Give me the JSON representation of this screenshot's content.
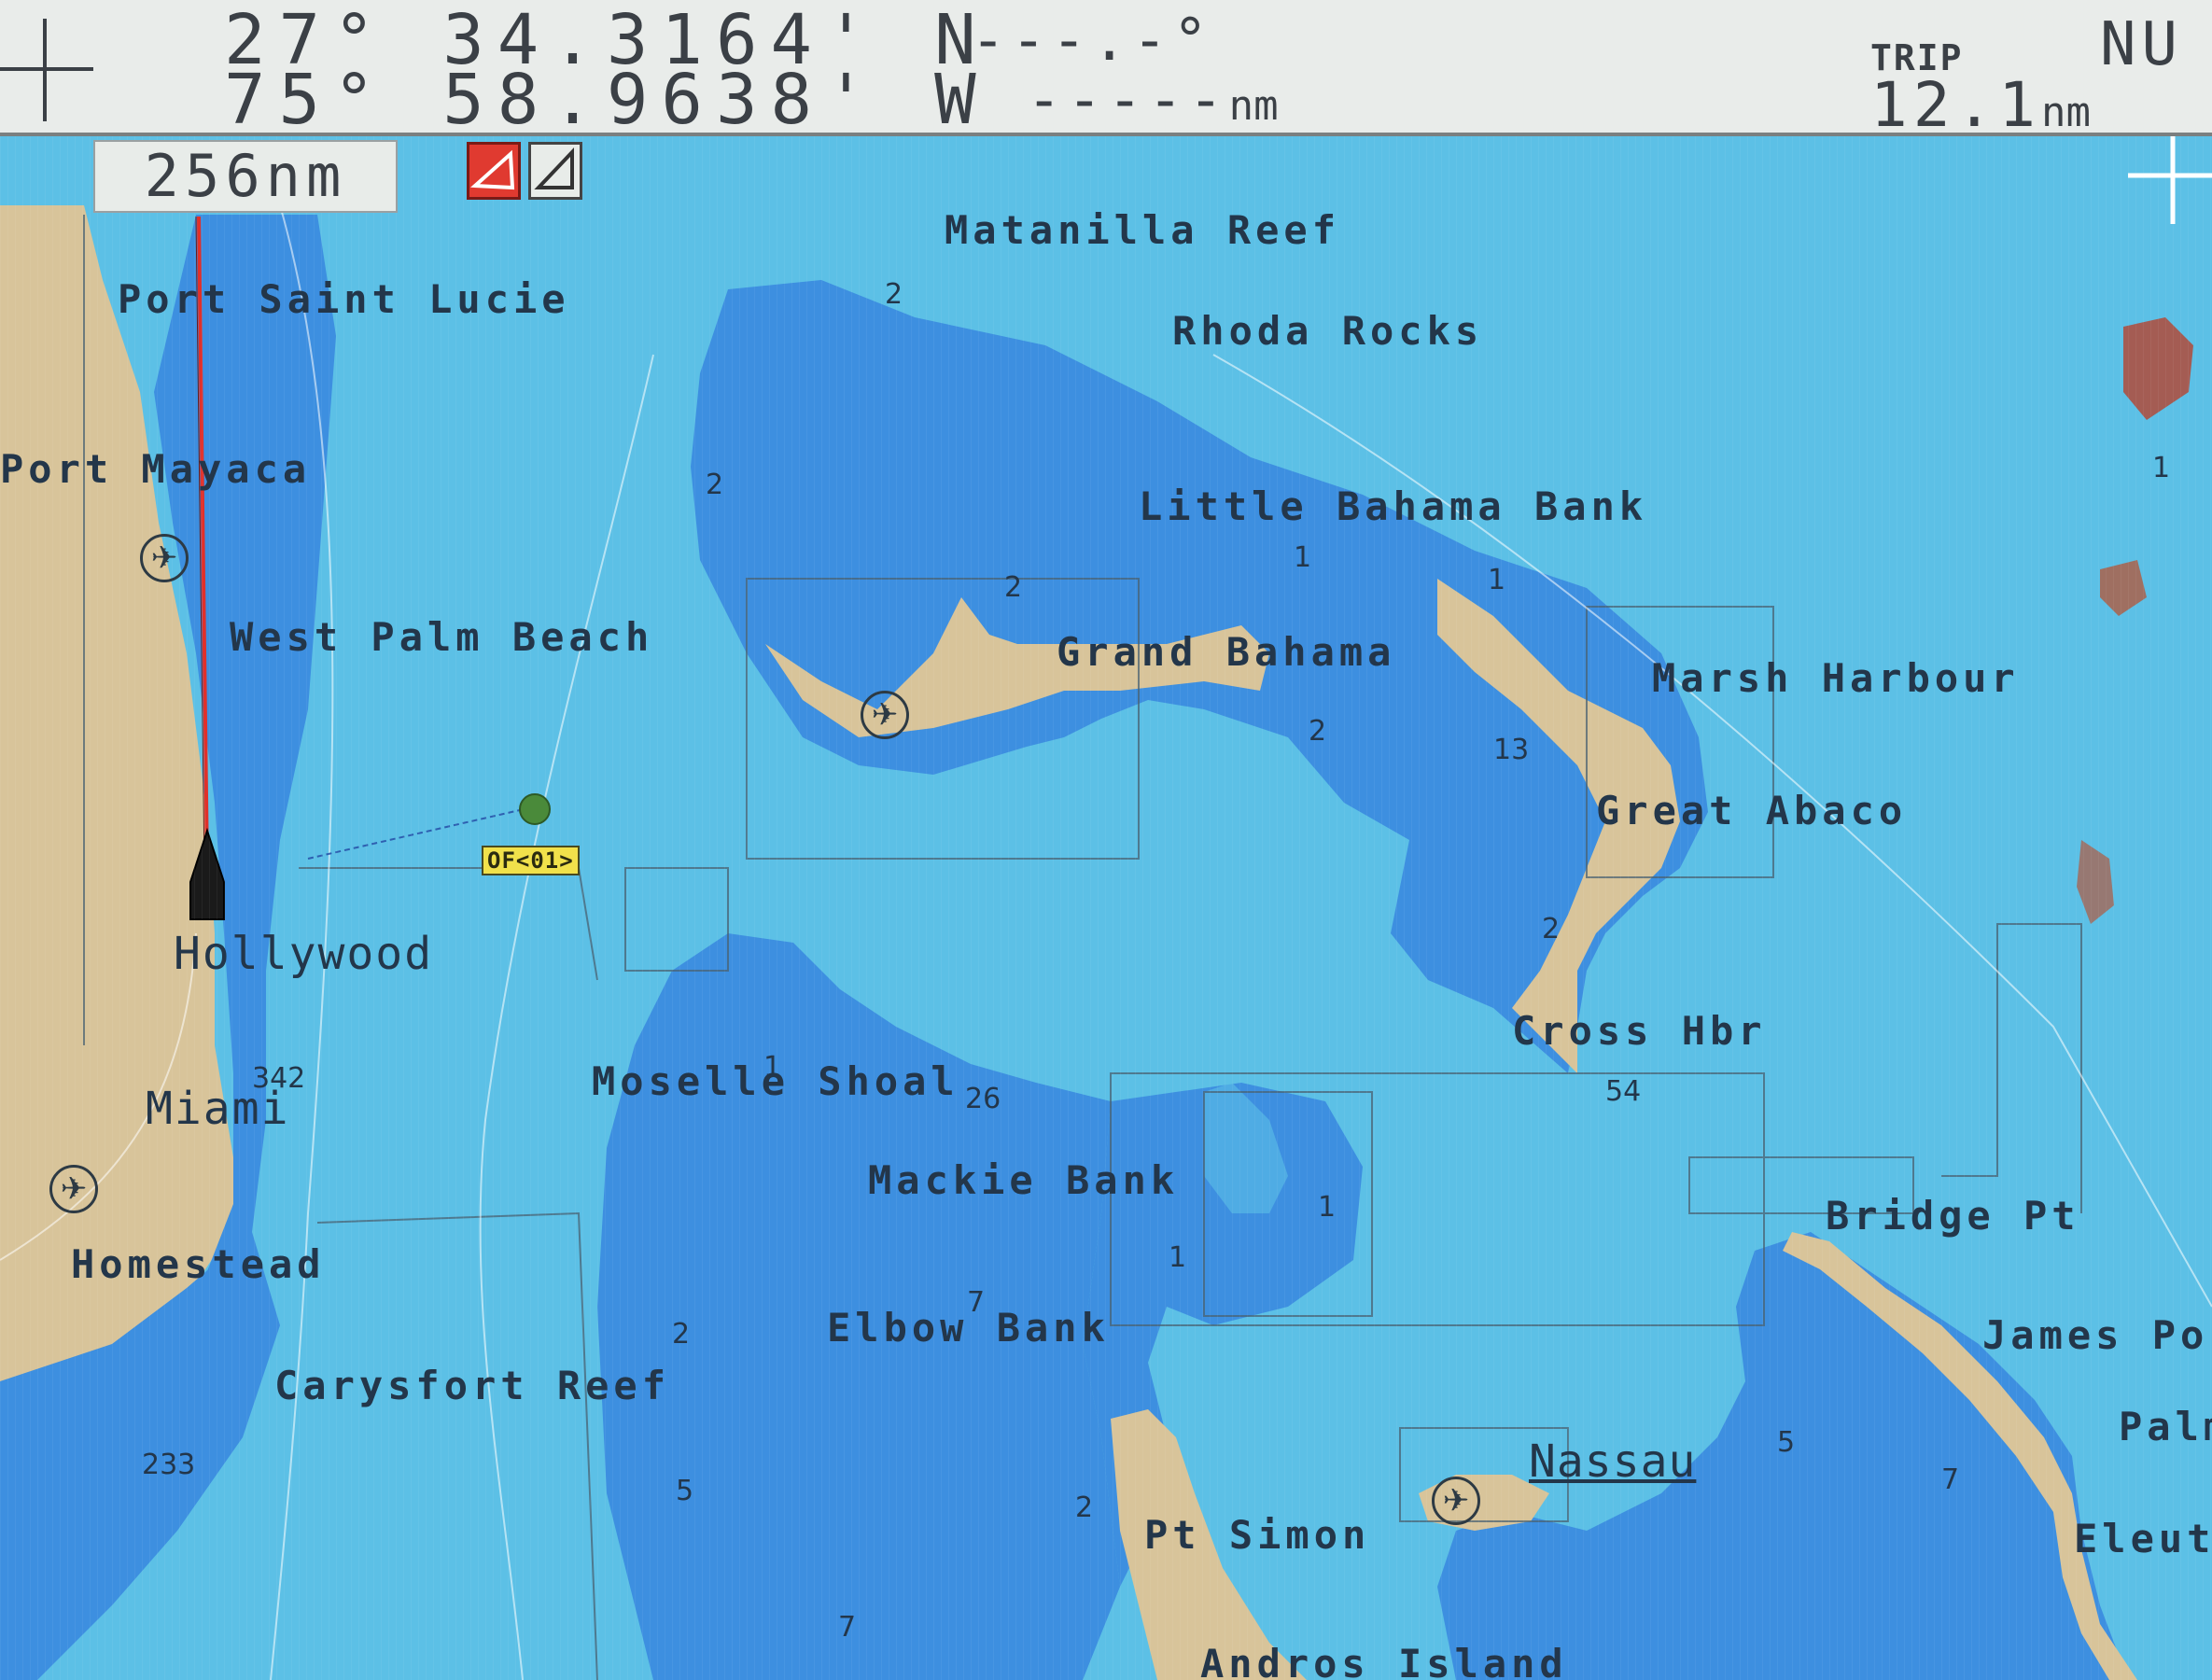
{
  "header": {
    "latitude": "27° 34.3164' N",
    "longitude": "75° 58.9638' W",
    "bearing": "---.-°",
    "distance_value": "-----",
    "distance_unit": "nm",
    "trip_label": "TRIP",
    "trip_value": "12.1",
    "trip_unit": "nm",
    "corner_label": "NU"
  },
  "range": {
    "value": "256nm"
  },
  "waypoint": {
    "label": "OF<01>"
  },
  "map_labels": {
    "matanilla_reef": "Matanilla Reef",
    "rhoda_rocks": "Rhoda Rocks",
    "port_saint_lucie": "Port Saint Lucie",
    "port_mayaca": "Port Mayaca",
    "little_bahama_bank": "Little Bahama Bank",
    "west_palm_beach": "West Palm Beach",
    "grand_bahama": "Grand Bahama",
    "marsh_harbour": "Marsh Harbour",
    "great_abaco": "Great Abaco",
    "hollywood": "Hollywood",
    "cross_hbr": "Cross Hbr",
    "moselle_shoal": "Moselle Shoal",
    "miami": "Miami",
    "mackie_bank": "Mackie Bank",
    "bridge_pt": "Bridge Pt",
    "homestead": "Homestead",
    "james_point": "James Po",
    "elbow_bank": "Elbow Bank",
    "carysfort_reef": "Carysfort Reef",
    "palm": "Palm",
    "nassau": "Nassau",
    "pt_simon": "Pt Simon",
    "eleuthera": "Eleut",
    "andros_island": "Andros Island"
  },
  "depths": {
    "d1": "2",
    "d2": "2",
    "d3": "2",
    "d4": "1",
    "d5": "1",
    "d6": "2",
    "d7": "13",
    "d8": "2",
    "d9": "54",
    "d10": "26",
    "d11": "1",
    "d12": "1",
    "d13": "1",
    "d14": "7",
    "d15": "2",
    "d16": "5",
    "d17": "2",
    "d18": "7",
    "d19": "5",
    "d20": "7",
    "d21": "342",
    "d22": "233",
    "d23": "1"
  },
  "icons": {
    "airport": "airport-icon",
    "cursor": "crosshair-icon",
    "vessel": "vessel-icon",
    "waypoint": "waypoint-icon"
  },
  "colors": {
    "deep_water": "#5cc0e6",
    "shallow_water": "#3d8fe0",
    "land": "#d8c49a",
    "data_bar": "#e9ecea",
    "heading_line": "#e0302a"
  }
}
